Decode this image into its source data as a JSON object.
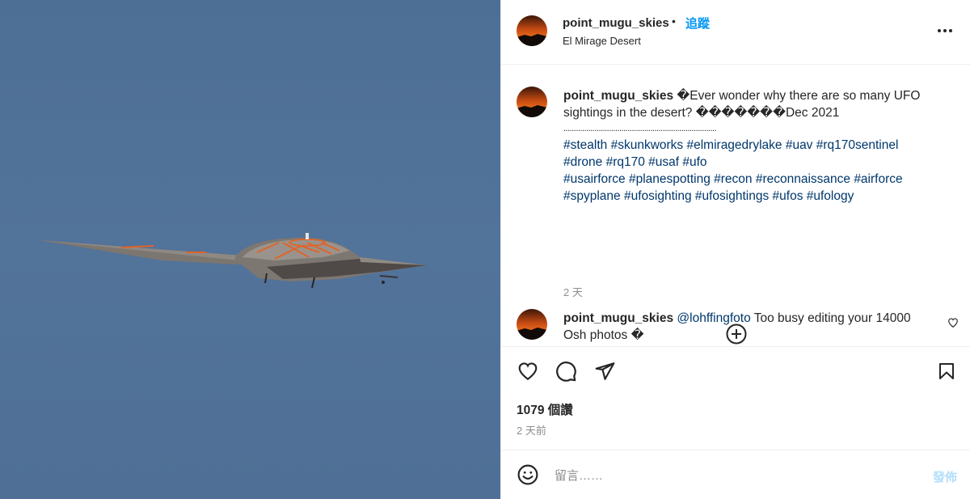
{
  "photo": {
    "alt_icon": "aircraft-photo"
  },
  "header": {
    "username": "point_mugu_skies",
    "separator": "•",
    "follow_label": "追蹤",
    "location": "El Mirage Desert",
    "more_icon": "more-options-icon"
  },
  "caption": {
    "username": "point_mugu_skies",
    "text_line": "�Ever wonder why there are so many UFO sightings in the desert? �������Dec 2021",
    "dots": "..........................................................................",
    "tags_line1": "#stealth #skunkworks #elmiragedrylake #uav #rq170sentinel",
    "tags_line2": "#drone #rq170 #usaf #ufo",
    "tags_line3": "#usairforce #planespotting #recon #reconnaissance #airforce",
    "tags_line4": "#spyplane #ufosighting #ufosightings #ufos #ufology",
    "time": "2 天"
  },
  "reply": {
    "username": "point_mugu_skies",
    "mention": "@lohffingfoto",
    "text": "Too busy editing your 14000 Osh photos �"
  },
  "actions": {
    "likes": "1079 個讚",
    "time": "2 天前"
  },
  "compose": {
    "placeholder": "留言……",
    "post_label": "發佈"
  },
  "colors": {
    "accent": "#0095f6",
    "link": "#00376b",
    "muted": "#8e8e8e",
    "post_disabled": "#b2dffc",
    "sky": "#52739a"
  }
}
